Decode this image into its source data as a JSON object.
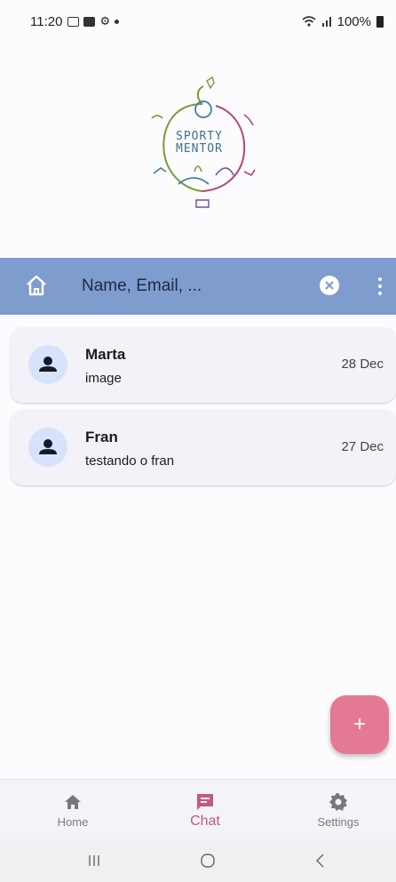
{
  "status_bar": {
    "time": "11:20",
    "battery": "100%"
  },
  "logo": {
    "line1": "SPORTY",
    "line2": "MENTOR"
  },
  "search": {
    "placeholder": "Name, Email, ..."
  },
  "chats": [
    {
      "name": "Marta",
      "last_message": "image",
      "date": "28 Dec"
    },
    {
      "name": "Fran",
      "last_message": "testando o fran",
      "date": "27 Dec"
    }
  ],
  "fab": {
    "label": "+"
  },
  "bottom_nav": {
    "items": [
      {
        "label": "Home",
        "icon": "home-icon"
      },
      {
        "label": "Chat",
        "icon": "chat-icon",
        "active": true
      },
      {
        "label": "Settings",
        "icon": "gear-icon"
      }
    ]
  },
  "colors": {
    "search_bar": "#7f9ccf",
    "accent": "#e37992",
    "active_nav": "#c45b7b",
    "avatar_bg": "#d6e3fb"
  }
}
